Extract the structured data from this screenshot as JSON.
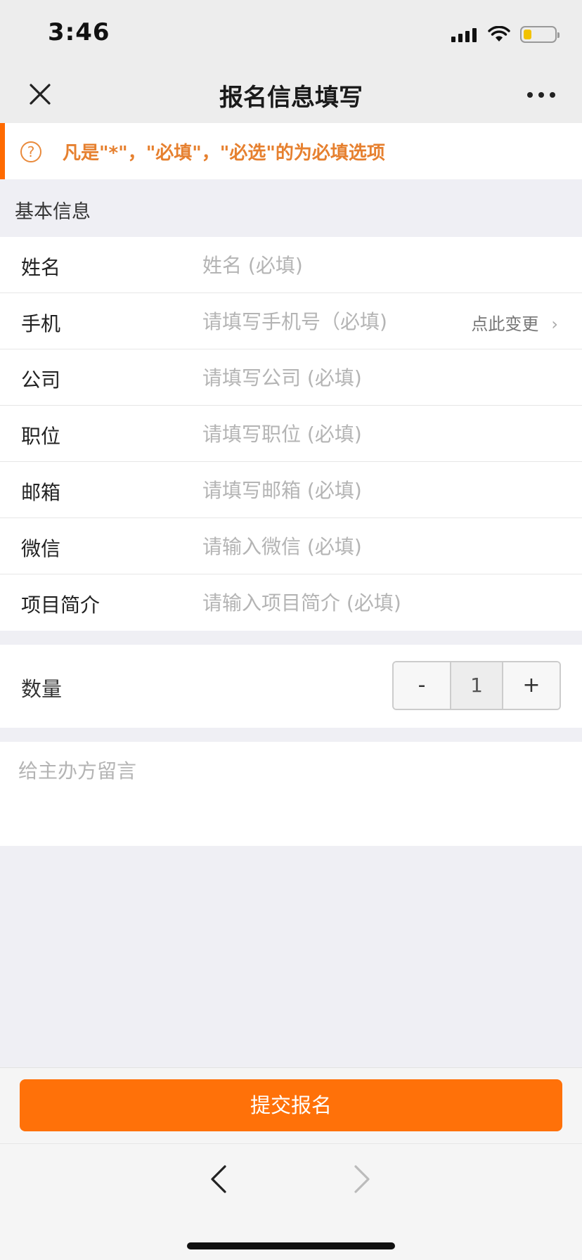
{
  "status_bar": {
    "time": "3:46"
  },
  "nav": {
    "title": "报名信息填写",
    "close_icon": "close-icon",
    "more_icon": "more-icon"
  },
  "notice": {
    "icon": "question-circle-icon",
    "text": "凡是\"*\"，\"必填\"，\"必选\"的为必填选项",
    "color": "#e6802f",
    "accent": "#ff6a00"
  },
  "section": {
    "title": "基本信息"
  },
  "form": {
    "rows": [
      {
        "label": "姓名",
        "placeholder": "姓名 (必填)"
      },
      {
        "label": "手机",
        "placeholder": "请填写手机号（必填)",
        "action": "点此变更"
      },
      {
        "label": "公司",
        "placeholder": "请填写公司 (必填)"
      },
      {
        "label": "职位",
        "placeholder": "请填写职位 (必填)"
      },
      {
        "label": "邮箱",
        "placeholder": "请填写邮箱 (必填)"
      },
      {
        "label": "微信",
        "placeholder": "请输入微信 (必填)"
      },
      {
        "label": "项目简介",
        "placeholder": "请输入项目简介 (必填)"
      }
    ]
  },
  "quantity": {
    "label": "数量",
    "minus": "-",
    "value": "1",
    "plus": "+"
  },
  "message": {
    "placeholder": "给主办方留言"
  },
  "submit": {
    "label": "提交报名",
    "color": "#ff7109"
  },
  "bottom_nav": {
    "back_icon": "chevron-left-icon",
    "forward_icon": "chevron-right-icon"
  }
}
